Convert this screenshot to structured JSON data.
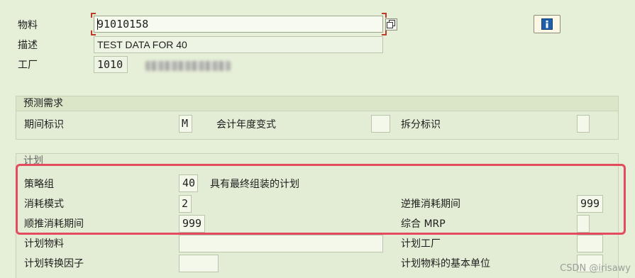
{
  "header": {
    "material": {
      "label": "物料",
      "value": "91010158"
    },
    "description": {
      "label": "描述",
      "value": "TEST DATA FOR 40"
    },
    "plant": {
      "label": "工厂",
      "value": "1010"
    }
  },
  "forecast": {
    "title": "预测需求",
    "period_indicator": {
      "label": "期间标识",
      "value": "M"
    },
    "fiscal_year_variant": {
      "label": "会计年度变式",
      "value": ""
    },
    "split_indicator": {
      "label": "拆分标识",
      "value": ""
    }
  },
  "planning": {
    "title": "计划",
    "strategy_group": {
      "label": "策略组",
      "value": "40",
      "text": "具有最终组装的计划"
    },
    "consumption_mode": {
      "label": "消耗模式",
      "value": "2"
    },
    "backward_consumption": {
      "label": "逆推消耗期间",
      "value": "999"
    },
    "forward_consumption": {
      "label": "顺推消耗期间",
      "value": "999"
    },
    "mixed_mrp": {
      "label": "综合 MRP",
      "value": ""
    },
    "planning_material": {
      "label": "计划物料",
      "value": ""
    },
    "planning_plant": {
      "label": "计划工厂",
      "value": ""
    },
    "conversion_factor": {
      "label": "计划转换因子",
      "value": ""
    },
    "planning_material_base_unit": {
      "label": "计划物料的基本单位",
      "value": ""
    }
  },
  "watermark": "CSDN @irisawy",
  "colors": {
    "highlight": "#e34b5e",
    "background": "#e6efd8"
  }
}
